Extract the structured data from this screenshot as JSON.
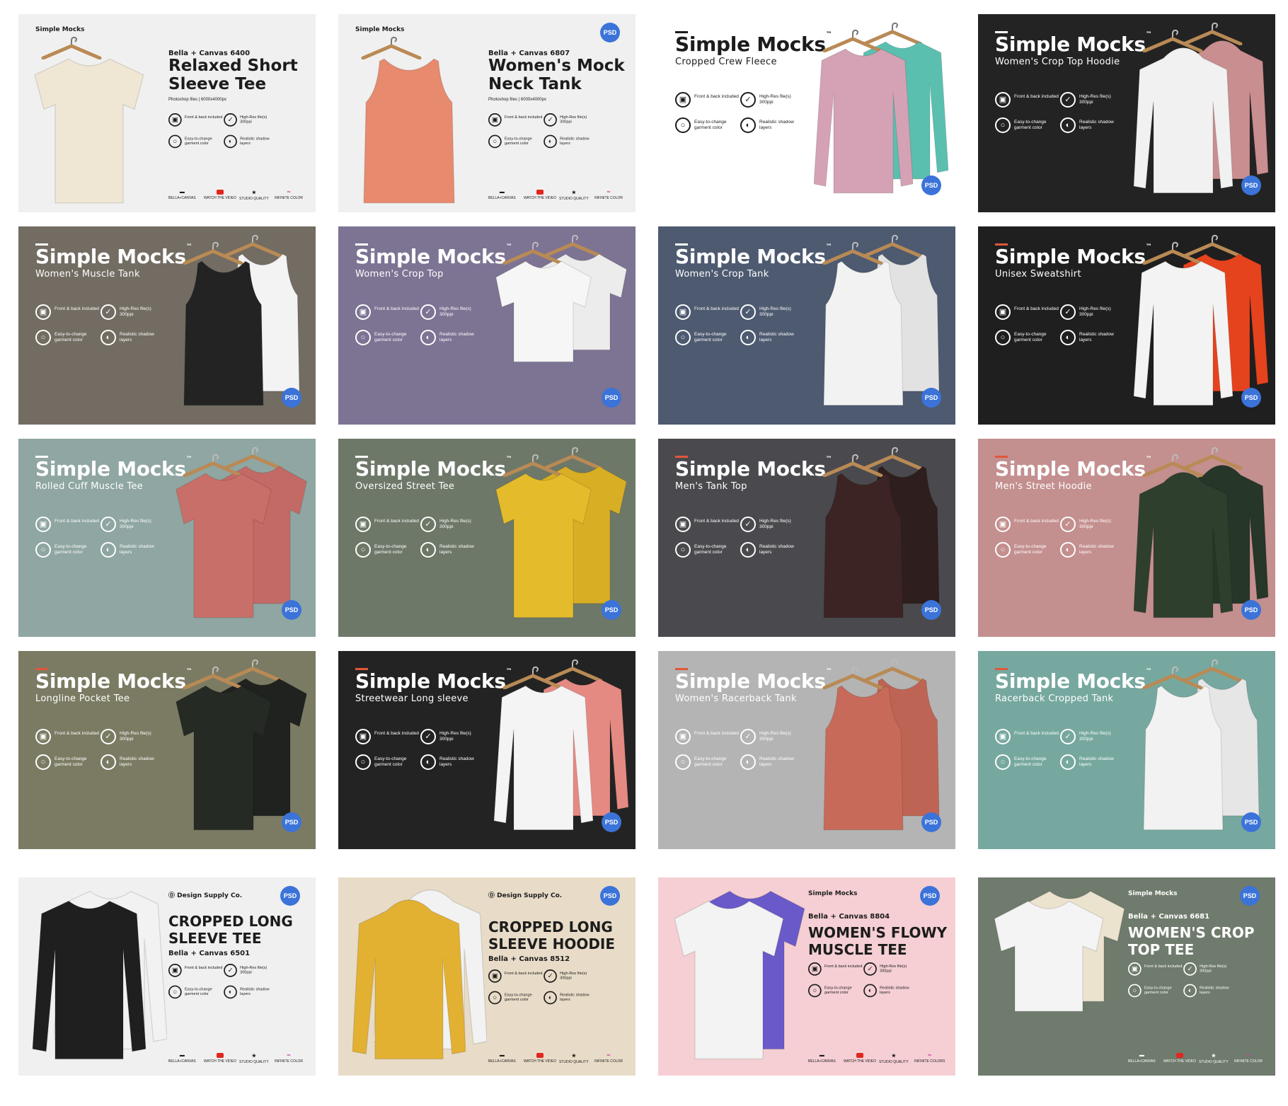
{
  "features": [
    {
      "icon": "shirt-icon",
      "glyph": "▣",
      "text": "Front & back included"
    },
    {
      "icon": "check-icon",
      "glyph": "✓",
      "text": "High-Res file(s) 300ppi"
    },
    {
      "icon": "drop-icon",
      "glyph": "○",
      "text": "Easy-to-change garment color"
    },
    {
      "icon": "shadow-icon",
      "glyph": "◐",
      "text": "Realistic shadow layers"
    }
  ],
  "footer_logos": {
    "bella": "BELLA+CANVAS",
    "video": "WATCH THE VIDEO",
    "quality": "STUDIO QUALITY",
    "color": "INFINITE COLOR",
    "colors": "INFINITE COLORS"
  },
  "badge": "PSD",
  "cards": [
    {
      "layout": "right",
      "small_brand": "Simple Mocks",
      "model": "Bella + Canvas 6400",
      "title": "Relaxed Short Sleeve Tee",
      "note": "Photoshop files | 6000x4000px",
      "badge": false,
      "bg": "#f0f0f0",
      "garment_color": "#efe7d4"
    },
    {
      "layout": "right",
      "small_brand": "Simple Mocks",
      "model": "Bella + Canvas 6807",
      "title": "Women's Mock Neck Tank",
      "note": "Photoshop files | 6000x4000px",
      "badge": true,
      "bg": "#f0f0f0",
      "garment_color": "#e78a6e"
    },
    {
      "layout": "big",
      "brand": "Simple Mocks",
      "subtitle": "Cropped Crew Fleece",
      "bg": "#ffffff",
      "garment_color": "#d4a2b4",
      "second_color": "#5bbfb0"
    },
    {
      "layout": "big",
      "brand": "Simple Mocks",
      "subtitle": "Women's Crop Top Hoodie",
      "bg": "#232323",
      "garment_color": "#f1f1f1",
      "second_color": "#c98e90"
    },
    {
      "layout": "big",
      "brand": "Simple Mocks",
      "subtitle": "Women's Muscle Tank",
      "bg": "#726c62",
      "garment_color": "#232323",
      "second_color": "#f3f3f3"
    },
    {
      "layout": "big",
      "brand": "Simple Mocks",
      "subtitle": "Women's Crop Top",
      "bg": "#7d7393",
      "garment_color": "#f6f6f6",
      "second_color": "#ececec"
    },
    {
      "layout": "big",
      "brand": "Simple Mocks",
      "subtitle": "Women's Crop Tank",
      "bg": "#4d5a70",
      "garment_color": "#f2f2f2",
      "second_color": "#e2e2e2"
    },
    {
      "layout": "big",
      "brand": "Simple Mocks",
      "subtitle": "Unisex Sweatshirt",
      "bg": "#1f1f1f",
      "garment_color": "#f3f3f3",
      "second_color": "#e5431d"
    },
    {
      "layout": "big",
      "brand": "Simple Mocks",
      "subtitle": "Rolled Cuff Muscle Tee",
      "bg": "#8fa6a2",
      "garment_color": "#c96f69",
      "second_color": "#c36a66"
    },
    {
      "layout": "big",
      "brand": "Simple Mocks",
      "subtitle": "Oversized Street Tee",
      "bg": "#6d7868",
      "garment_color": "#e4bc2b",
      "second_color": "#d8ae24"
    },
    {
      "layout": "big",
      "brand": "Simple Mocks",
      "subtitle": "Men's Tank Top",
      "bg": "#4a4a4e",
      "garment_color": "#3b2423",
      "second_color": "#2f1e1e"
    },
    {
      "layout": "big",
      "brand": "Simple Mocks",
      "subtitle": "Men's Street Hoodie",
      "bg": "#c48f8f",
      "garment_color": "#2e3f2e",
      "second_color": "#263628"
    },
    {
      "layout": "big",
      "brand": "Simple Mocks",
      "subtitle": "Longline Pocket Tee",
      "bg": "#7b7b63",
      "garment_color": "#262a25",
      "second_color": "#1f221e"
    },
    {
      "layout": "big",
      "brand": "Simple Mocks",
      "subtitle": "Streetwear Long sleeve",
      "bg": "#232323",
      "garment_color": "#f4f4f4",
      "second_color": "#e58a83"
    },
    {
      "layout": "big",
      "brand": "Simple Mocks",
      "subtitle": "Women's Racerback Tank",
      "bg": "#b4b4b4",
      "garment_color": "#c86a5a",
      "second_color": "#be6454"
    },
    {
      "layout": "big",
      "brand": "Simple Mocks",
      "subtitle": "Racerback Cropped Tank",
      "bg": "#76a89f",
      "garment_color": "#f2f2f2",
      "second_color": "#e6e6e6"
    },
    {
      "layout": "caps",
      "small_brand": "Design Supply Co.",
      "title": "CROPPED LONG SLEEVE TEE",
      "model": "Bella + Canvas 6501",
      "badge": true,
      "bg": "#f0f0f0",
      "garment_color": "#1f1f1f",
      "second_color": "#f2f2f2"
    },
    {
      "layout": "caps",
      "small_brand": "Design Supply Co.",
      "title": "CROPPED LONG SLEEVE HOODIE",
      "model": "Bella + Canvas 8512",
      "badge": true,
      "bg": "#e8dcc8",
      "garment_color": "#e3b132",
      "second_color": "#f2f2f2"
    },
    {
      "layout": "caps2",
      "small_brand": "Simple Mocks",
      "model": "Bella + Canvas 8804",
      "title": "WOMEN'S FLOWY MUSCLE TEE",
      "badge": true,
      "bg": "#f5cfd3",
      "garment_color": "#f3f3f3",
      "second_color": "#6a5ac9"
    },
    {
      "layout": "caps2",
      "small_brand": "Simple Mocks",
      "model": "Bella + Canvas 6681",
      "title": "WOMEN'S CROP TOP TEE",
      "badge": true,
      "bg": "#6f7b6c",
      "garment_color": "#f4f4f4",
      "second_color": "#ece3cf"
    }
  ]
}
